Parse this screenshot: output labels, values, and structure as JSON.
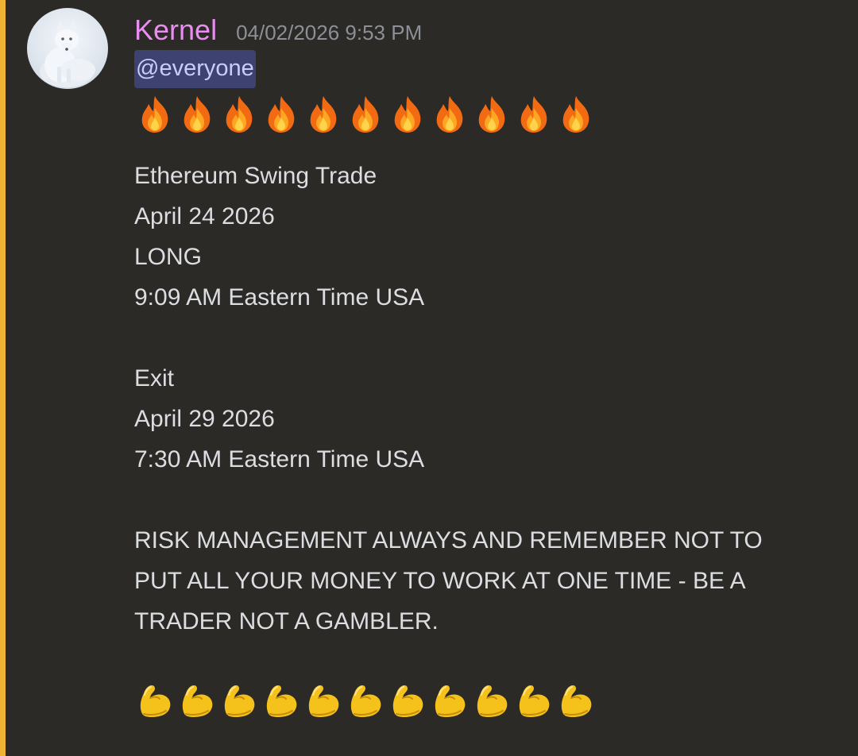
{
  "message": {
    "author": "Kernel",
    "timestamp": "04/02/2026 9:53 PM",
    "mention": "@everyone",
    "emoji_top": "fire-emoji",
    "emoji_top_count": 11,
    "entry_lines": [
      "Ethereum Swing Trade",
      "April 24 2026",
      "LONG",
      "9:09 AM Eastern Time USA"
    ],
    "exit_lines": [
      "Exit",
      "April 29 2026",
      "7:30 AM Eastern Time USA"
    ],
    "warning_lines": [
      "RISK MANAGEMENT ALWAYS AND REMEMBER NOT TO",
      "PUT ALL YOUR MONEY TO WORK AT ONE TIME - BE A",
      "TRADER NOT A GAMBLER."
    ],
    "emoji_bottom": "flexed-biceps-emoji",
    "emoji_bottom_count": 11
  },
  "colors": {
    "background": "#2c2a27",
    "highlight_bar": "#f0b232",
    "username": "#e98ef0",
    "timestamp": "#8d8f96",
    "text": "#dcdde1",
    "mention_bg": "#3e4270",
    "mention_text": "#c9cdfb"
  }
}
